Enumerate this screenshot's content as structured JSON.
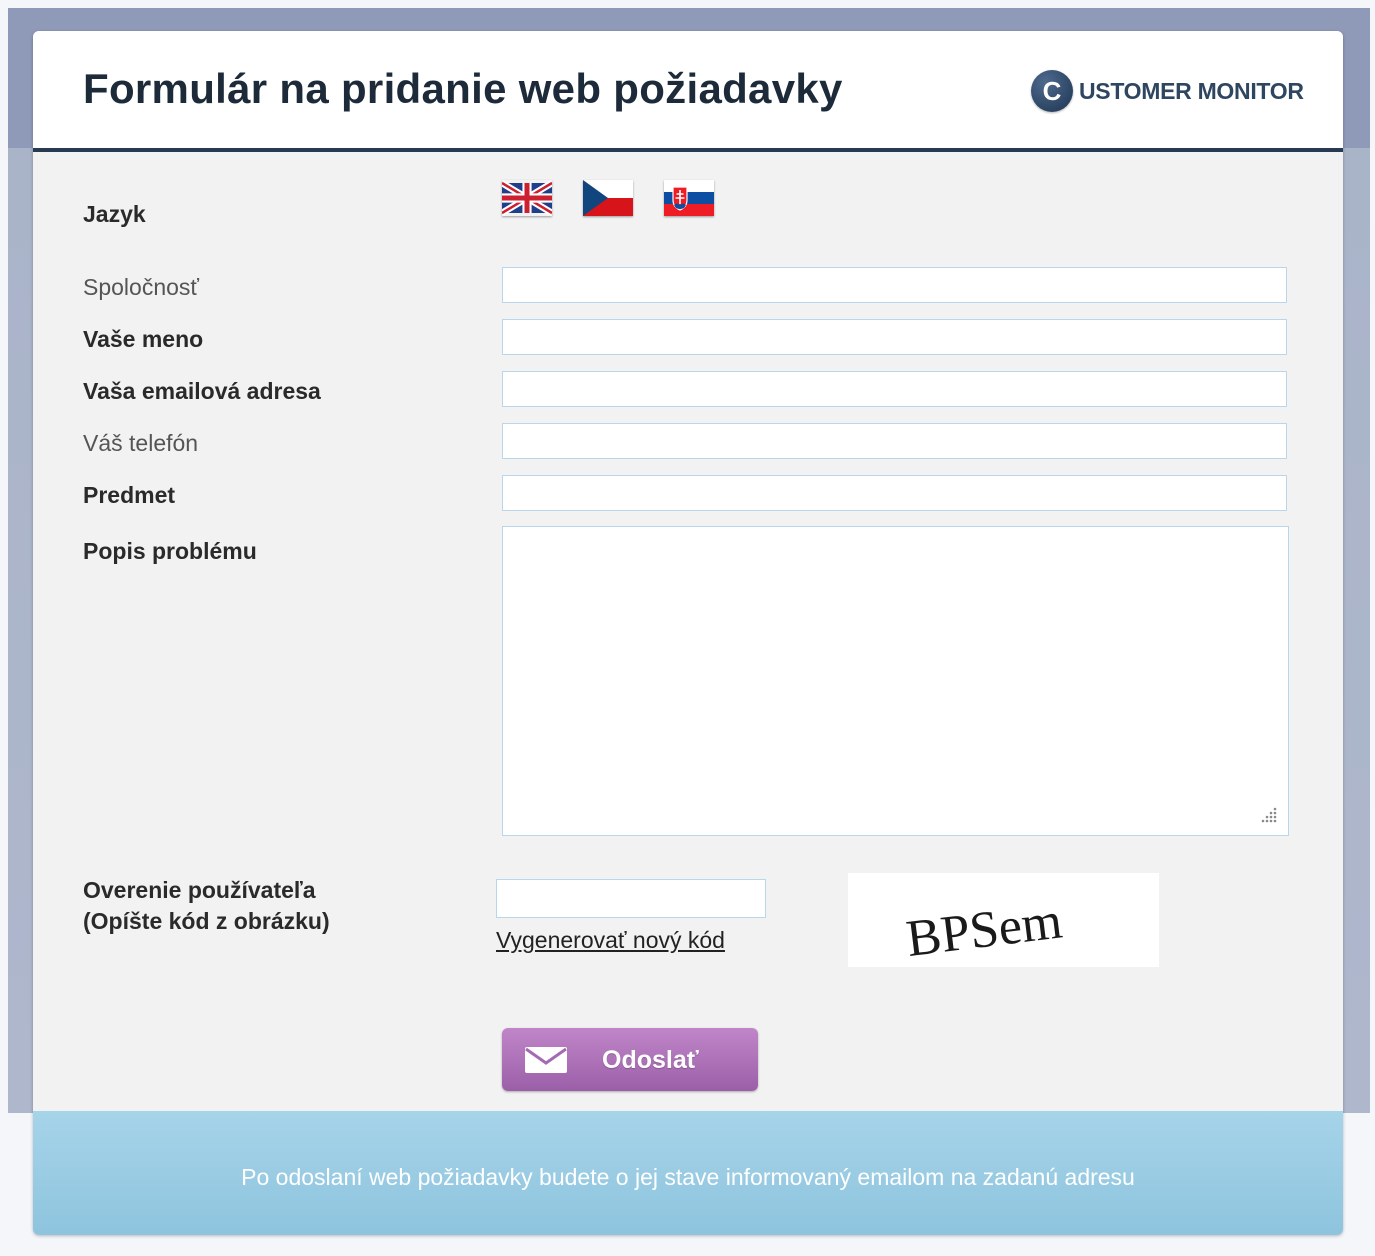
{
  "header": {
    "title": "Formulár na pridanie web požiadavky",
    "logo_letter": "C",
    "logo_text": "USTOMER MONITOR"
  },
  "form": {
    "language_label": "Jazyk",
    "languages": [
      {
        "icon": "flag-uk-icon",
        "name": "English"
      },
      {
        "icon": "flag-cz-icon",
        "name": "Čeština"
      },
      {
        "icon": "flag-sk-icon",
        "name": "Slovenčina"
      }
    ],
    "company": {
      "label": "Spoločnosť",
      "value": ""
    },
    "name": {
      "label": "Vaše meno",
      "value": ""
    },
    "email": {
      "label": "Vaša emailová adresa",
      "value": ""
    },
    "phone": {
      "label": "Váš telefón",
      "value": ""
    },
    "subject": {
      "label": "Predmet",
      "value": ""
    },
    "description": {
      "label": "Popis problému",
      "value": ""
    },
    "captcha": {
      "label_line1": "Overenie používateľa",
      "label_line2": "(Opíšte kód z obrázku)",
      "value": "",
      "regenerate_link": "Vygenerovať nový kód",
      "image_text": "BPSem"
    },
    "submit_label": "Odoslať"
  },
  "footer": {
    "text": "Po odoslaní web požiadavky budete o jej stave informovaný emailom na zadanú adresu"
  },
  "colors": {
    "header_border": "#263a52",
    "title": "#1d2a3a",
    "submit": "#ab6db6",
    "footer": "#9ccbe2",
    "input_border": "#b9d7ea"
  }
}
